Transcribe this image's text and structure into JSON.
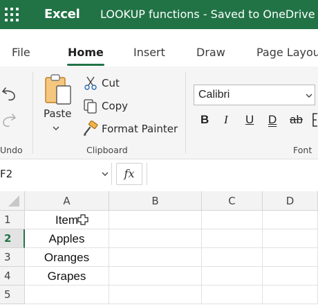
{
  "titlebar": {
    "app_name": "Excel",
    "doc_title": "LOOKUP functions  -  Saved to OneDrive",
    "bg_color": "#217346"
  },
  "tabs": [
    {
      "label": "File"
    },
    {
      "label": "Home",
      "active": true
    },
    {
      "label": "Insert"
    },
    {
      "label": "Draw"
    },
    {
      "label": "Page Layout"
    }
  ],
  "ribbon": {
    "undo_group_label": "Undo",
    "clipboard": {
      "paste_label": "Paste",
      "cut_label": "Cut",
      "copy_label": "Copy",
      "format_painter_label": "Format Painter",
      "group_label": "Clipboard"
    },
    "font": {
      "font_name": "Calibri",
      "group_label": "Font",
      "bold": "B",
      "italic": "I",
      "underline": "U",
      "double_underline": "D",
      "strikethrough": "ab"
    }
  },
  "formula_bar": {
    "name_box": "F2",
    "fx_label": "fx",
    "formula": ""
  },
  "grid": {
    "columns": [
      "A",
      "B",
      "C",
      "D"
    ],
    "rows": [
      "1",
      "2",
      "3",
      "4",
      "5"
    ],
    "active_row": "2",
    "cells": {
      "A1": "Item",
      "A2": "Apples",
      "A3": "Oranges",
      "A4": "Grapes"
    }
  }
}
